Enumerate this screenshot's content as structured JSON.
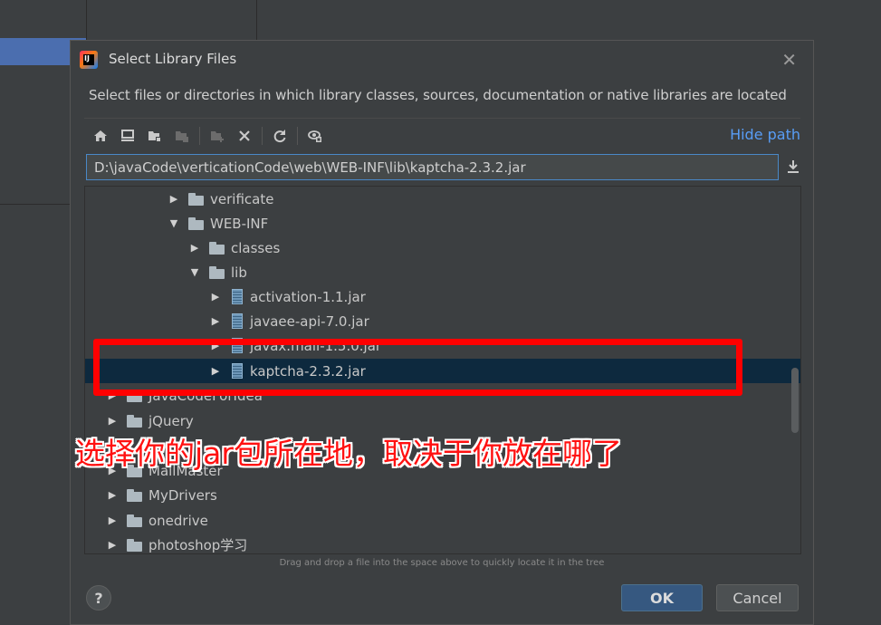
{
  "dialog": {
    "title": "Select Library Files",
    "description": "Select files or directories in which library classes, sources, documentation or native libraries are located",
    "hide_path_label": "Hide path",
    "path_value": "D:\\javaCode\\verticationCode\\web\\WEB-INF\\lib\\kaptcha-2.3.2.jar",
    "drag_hint": "Drag and drop a file into the space above to quickly locate it in the tree",
    "help_label": "?",
    "ok_label": "OK",
    "cancel_label": "Cancel"
  },
  "toolbar": {
    "buttons": [
      "home-icon",
      "desktop-icon",
      "project-folder-icon",
      "module-folder-icon",
      "new-folder-icon",
      "delete-icon",
      "refresh-icon",
      "show-hidden-icon"
    ]
  },
  "tree": {
    "rows": [
      {
        "label": "verificate",
        "type": "folder",
        "expanded": false
      },
      {
        "label": "WEB-INF",
        "type": "folder",
        "expanded": true
      },
      {
        "label": "classes",
        "type": "folder",
        "expanded": false
      },
      {
        "label": "lib",
        "type": "folder",
        "expanded": true
      },
      {
        "label": "activation-1.1.jar",
        "type": "jar",
        "expanded": false
      },
      {
        "label": "javaee-api-7.0.jar",
        "type": "jar",
        "expanded": false
      },
      {
        "label": "javax.mail-1.5.0.jar",
        "type": "jar",
        "expanded": false
      },
      {
        "label": "kaptcha-2.3.2.jar",
        "type": "jar",
        "expanded": false,
        "selected": true
      },
      {
        "label": "JavaCodeForIdea",
        "type": "folder",
        "expanded": false
      },
      {
        "label": "jQuery",
        "type": "folder",
        "expanded": false
      },
      {
        "label": "MailMaster",
        "type": "folder",
        "expanded": false
      },
      {
        "label": "MyDrivers",
        "type": "folder",
        "expanded": false
      },
      {
        "label": "onedrive",
        "type": "folder",
        "expanded": false
      },
      {
        "label": "photoshop学习",
        "type": "folder",
        "expanded": false
      }
    ]
  },
  "annotation": {
    "text": "选择你的jar包所在地，取决于你放在哪了",
    "color": "#ff0000"
  },
  "colors": {
    "background": "#3c3f41",
    "selection": "#0d293e",
    "link": "#589df6",
    "ok_button": "#365880"
  }
}
